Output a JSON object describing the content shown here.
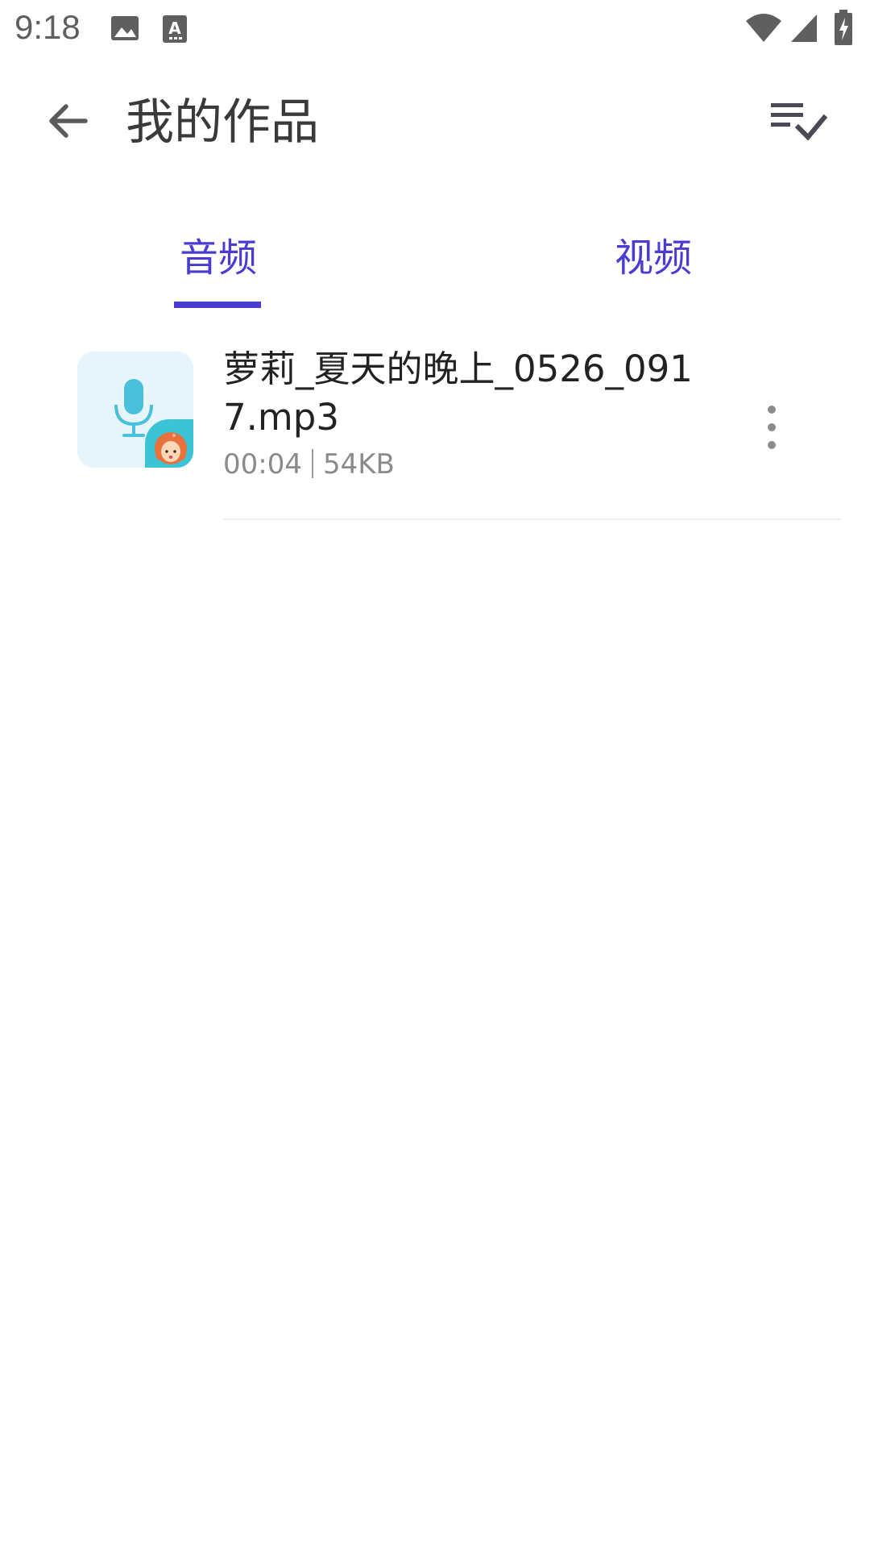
{
  "status_bar": {
    "time": "9:18",
    "icons": [
      "image-icon",
      "text-notification-icon",
      "wifi-icon",
      "signal-icon",
      "battery-charging-icon"
    ]
  },
  "app_bar": {
    "back_icon": "arrow-left-icon",
    "title": "我的作品",
    "select_icon": "list-check-icon"
  },
  "tabs": [
    {
      "label": "音频",
      "selected": true
    },
    {
      "label": "视频",
      "selected": false
    }
  ],
  "items": [
    {
      "title": "萝莉_夏天的晚上_0526_0917.mp3",
      "duration": "00:04",
      "size": "54KB",
      "thumb_icon": "microphone-icon",
      "avatar_icon": "girl-avatar-icon",
      "menu_icon": "more-vertical-icon"
    }
  ],
  "colors": {
    "accent": "#4a3bd1",
    "icon_gray": "#5a5a5a",
    "thumb_bg": "#e7f5fb",
    "mic": "#49c0dc"
  }
}
